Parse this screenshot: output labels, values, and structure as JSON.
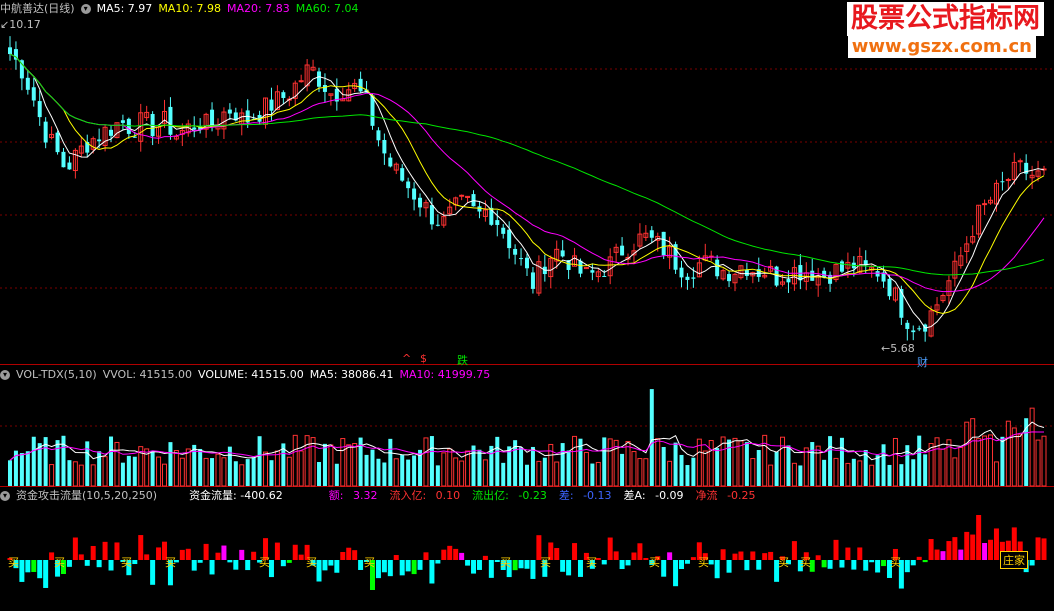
{
  "main_header": {
    "stock_name": "中航善达(日线)",
    "ma5": "MA5: 7.97",
    "ma10": "MA10: 7.98",
    "ma20": "MA20: 7.83",
    "ma60": "MA60: 7.04"
  },
  "vol_header": {
    "name": "VOL-TDX(5,10)",
    "vvol": "VVOL: 41515.00",
    "volume": "VOLUME: 41515.00",
    "ma5": "MA5: 38086.41",
    "ma10": "MA10: 41999.75"
  },
  "flow_header": {
    "name": "资金攻击流量(10,5,20,250)",
    "flow": "资金流量: -400.62",
    "amount_label": "额:",
    "amount_value": "3.32",
    "inflow_label": "流入亿:",
    "inflow_value": "0.10",
    "outflow_label": "流出亿:",
    "outflow_value": "-0.23",
    "diff_label": "差:",
    "diff_value": "-0.13",
    "diffa_label": "差A:",
    "diffa_value": "-0.09",
    "net_label": "净流",
    "net_value": "-0.25"
  },
  "annotations": {
    "high_marker": "10.17",
    "low_marker": "5.68",
    "finance_tag": "财",
    "dollar_tag": "$",
    "drop_tag": "跌",
    "buy_label": "买",
    "zhuang_label": "庄家"
  },
  "watermark": {
    "title": "股票公式指标网",
    "url": "www.gszx.com.cn"
  },
  "colors": {
    "up": "#ff3232",
    "down": "#54ffff",
    "ma5": "#ffffff",
    "ma10": "#ffff00",
    "ma20": "#ff00ff",
    "ma60": "#00e600",
    "flow_pos": "#ff0000",
    "flow_neg": "#00ffff",
    "flow_strong_pos": "#ff00ff",
    "flow_strong_neg": "#00ff00"
  },
  "chart_data": {
    "type": "candlestick",
    "y_range": [
      5.5,
      10.3
    ],
    "closes": [
      9.8,
      9.6,
      9.2,
      8.7,
      8.4,
      8.1,
      8.3,
      8.5,
      8.6,
      8.7,
      8.8,
      8.7,
      8.8,
      8.7,
      8.8,
      8.6,
      8.7,
      8.8,
      8.7,
      8.9,
      9.0,
      8.8,
      8.9,
      9.0,
      9.1,
      9.2,
      9.4,
      9.6,
      9.4,
      9.2,
      9.3,
      9.3,
      9.1,
      8.6,
      8.2,
      8.0,
      7.8,
      7.6,
      7.4,
      7.3,
      7.5,
      7.6,
      7.4,
      7.5,
      7.3,
      7.0,
      6.7,
      6.4,
      6.7,
      6.9,
      6.8,
      6.6,
      6.5,
      6.6,
      6.7,
      6.9,
      7.0,
      7.1,
      7.0,
      6.9,
      6.7,
      6.6,
      6.7,
      6.7,
      6.6,
      6.6,
      6.7,
      6.6,
      6.6,
      6.5,
      6.6,
      6.6,
      6.6,
      6.5,
      6.6,
      6.6,
      6.7,
      6.6,
      6.6,
      6.4,
      6.1,
      5.8,
      5.8,
      6.0,
      6.3,
      6.6,
      7.0,
      7.4,
      7.6,
      7.8,
      8.0,
      8.1,
      8.0,
      8.0
    ],
    "volume_ma10": 41999.75,
    "volume_ma5": 38086.41
  }
}
